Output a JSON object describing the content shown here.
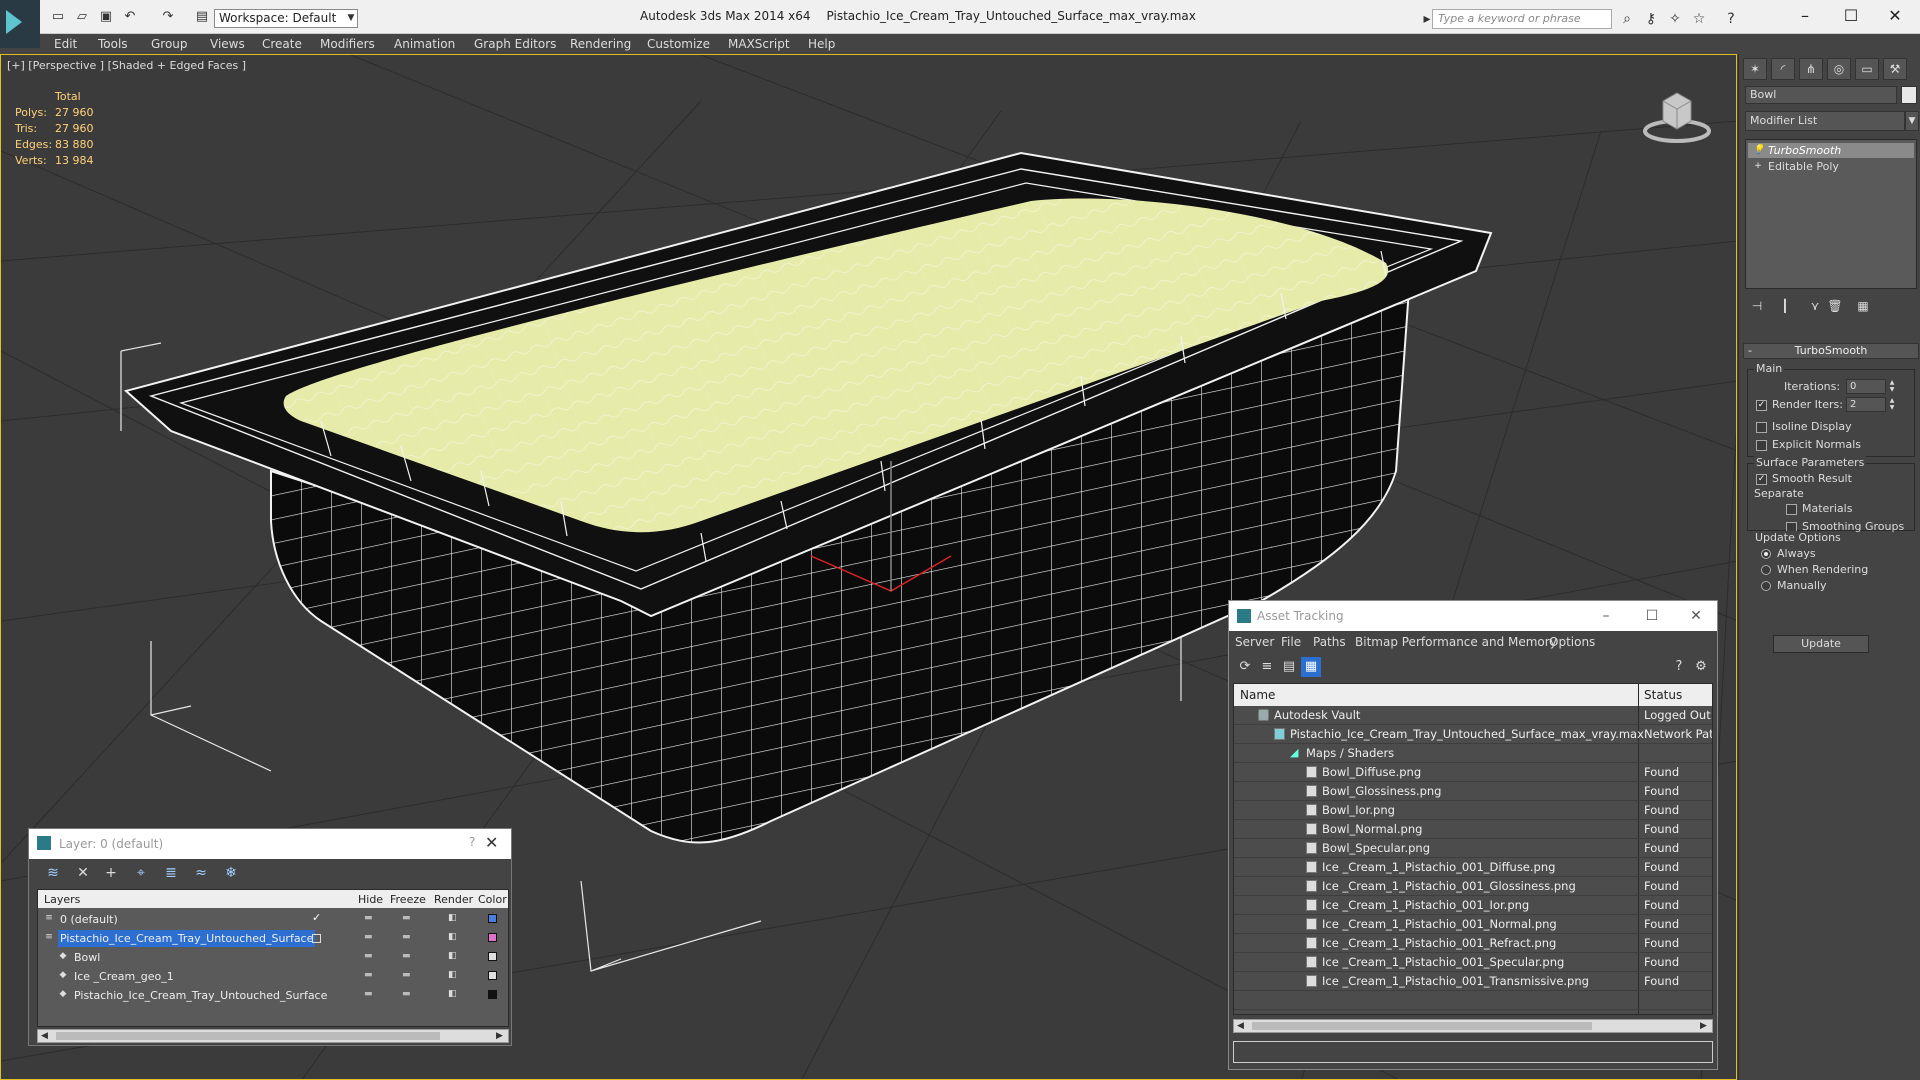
{
  "titlebar": {
    "workspace": "Workspace: Default",
    "app": "Autodesk 3ds Max  2014 x64",
    "file": "Pistachio_Ice_Cream_Tray_Untouched_Surface_max_vray.max",
    "search_placeholder": "Type a keyword or phrase"
  },
  "menu": [
    "Edit",
    "Tools",
    "Group",
    "Views",
    "Create",
    "Modifiers",
    "Animation",
    "Graph Editors",
    "Rendering",
    "Customize",
    "MAXScript",
    "Help"
  ],
  "viewport": {
    "label": "[+] [Perspective ] [Shaded + Edged Faces ]",
    "stats_header": "Total",
    "stats": [
      {
        "key": "Polys:",
        "value": "27 960"
      },
      {
        "key": "Tris:",
        "value": "27 960"
      },
      {
        "key": "Edges:",
        "value": "83 880"
      },
      {
        "key": "Verts:",
        "value": "13 984"
      }
    ]
  },
  "command_panel": {
    "object_name": "Bowl",
    "modifier_list": "Modifier List",
    "stack": [
      "TurboSmooth",
      "Editable Poly"
    ],
    "rollout_title": "TurboSmooth",
    "main_group": "Main",
    "iterations_label": "Iterations:",
    "iterations_value": "0",
    "render_iters_label": "Render Iters:",
    "render_iters_value": "2",
    "render_iters_checked": true,
    "isoline_label": "Isoline Display",
    "explicit_normals_label": "Explicit Normals",
    "surface_group": "Surface Parameters",
    "smooth_result_label": "Smooth Result",
    "separate_label": "Separate",
    "materials_label": "Materials",
    "smoothing_groups_label": "Smoothing Groups",
    "update_group": "Update Options",
    "always_label": "Always",
    "when_rendering_label": "When Rendering",
    "manually_label": "Manually",
    "update_button": "Update"
  },
  "layer_window": {
    "title": "Layer: 0 (default)",
    "help": "?",
    "columns": [
      "Layers",
      "Hide",
      "Freeze",
      "Render",
      "Color"
    ],
    "rows": [
      {
        "name": "0 (default)",
        "indent": 0,
        "color": "#4a7fe0",
        "selected": false,
        "active": true
      },
      {
        "name": "Pistachio_Ice_Cream_Tray_Untouched_Surface",
        "indent": 0,
        "color": "#e070c8",
        "selected": true,
        "active": false
      },
      {
        "name": "Bowl",
        "indent": 1,
        "color": "#e0e0e0",
        "selected": false,
        "active": false
      },
      {
        "name": "Ice _Cream_geo_1",
        "indent": 1,
        "color": "#e0e0e0",
        "selected": false,
        "active": false
      },
      {
        "name": "Pistachio_Ice_Cream_Tray_Untouched_Surface",
        "indent": 1,
        "color": "#111111",
        "selected": false,
        "active": false
      }
    ]
  },
  "asset_window": {
    "title": "Asset Tracking",
    "menu": [
      "Server",
      "File",
      "Paths",
      "Bitmap Performance and Memory",
      "Options"
    ],
    "columns": [
      "Name",
      "Status"
    ],
    "rows": [
      {
        "name": "Autodesk Vault",
        "status": "Logged Out ...",
        "indent": 1,
        "icon": "vault"
      },
      {
        "name": "Pistachio_Ice_Cream_Tray_Untouched_Surface_max_vray.max",
        "status": "Network Path",
        "indent": 2,
        "icon": "max"
      },
      {
        "name": "Maps / Shaders",
        "status": "",
        "indent": 3,
        "icon": "maps"
      },
      {
        "name": "Bowl_Diffuse.png",
        "status": "Found",
        "indent": 4,
        "icon": "file"
      },
      {
        "name": "Bowl_Glossiness.png",
        "status": "Found",
        "indent": 4,
        "icon": "file"
      },
      {
        "name": "Bowl_Ior.png",
        "status": "Found",
        "indent": 4,
        "icon": "file"
      },
      {
        "name": "Bowl_Normal.png",
        "status": "Found",
        "indent": 4,
        "icon": "file"
      },
      {
        "name": "Bowl_Specular.png",
        "status": "Found",
        "indent": 4,
        "icon": "file"
      },
      {
        "name": "Ice _Cream_1_Pistachio_001_Diffuse.png",
        "status": "Found",
        "indent": 4,
        "icon": "file"
      },
      {
        "name": "Ice _Cream_1_Pistachio_001_Glossiness.png",
        "status": "Found",
        "indent": 4,
        "icon": "file"
      },
      {
        "name": "Ice _Cream_1_Pistachio_001_Ior.png",
        "status": "Found",
        "indent": 4,
        "icon": "file"
      },
      {
        "name": "Ice _Cream_1_Pistachio_001_Normal.png",
        "status": "Found",
        "indent": 4,
        "icon": "file"
      },
      {
        "name": "Ice _Cream_1_Pistachio_001_Refract.png",
        "status": "Found",
        "indent": 4,
        "icon": "file"
      },
      {
        "name": "Ice _Cream_1_Pistachio_001_Specular.png",
        "status": "Found",
        "indent": 4,
        "icon": "file"
      },
      {
        "name": "Ice _Cream_1_Pistachio_001_Transmissive.png",
        "status": "Found",
        "indent": 4,
        "icon": "file"
      }
    ]
  },
  "colors": {
    "viewport_bg": "#3b3b3b",
    "selection": "#2d6fd1",
    "active_border": "#e0c020",
    "ice_cream": "#e6ebaa",
    "stats_text": "#ffd27a"
  }
}
